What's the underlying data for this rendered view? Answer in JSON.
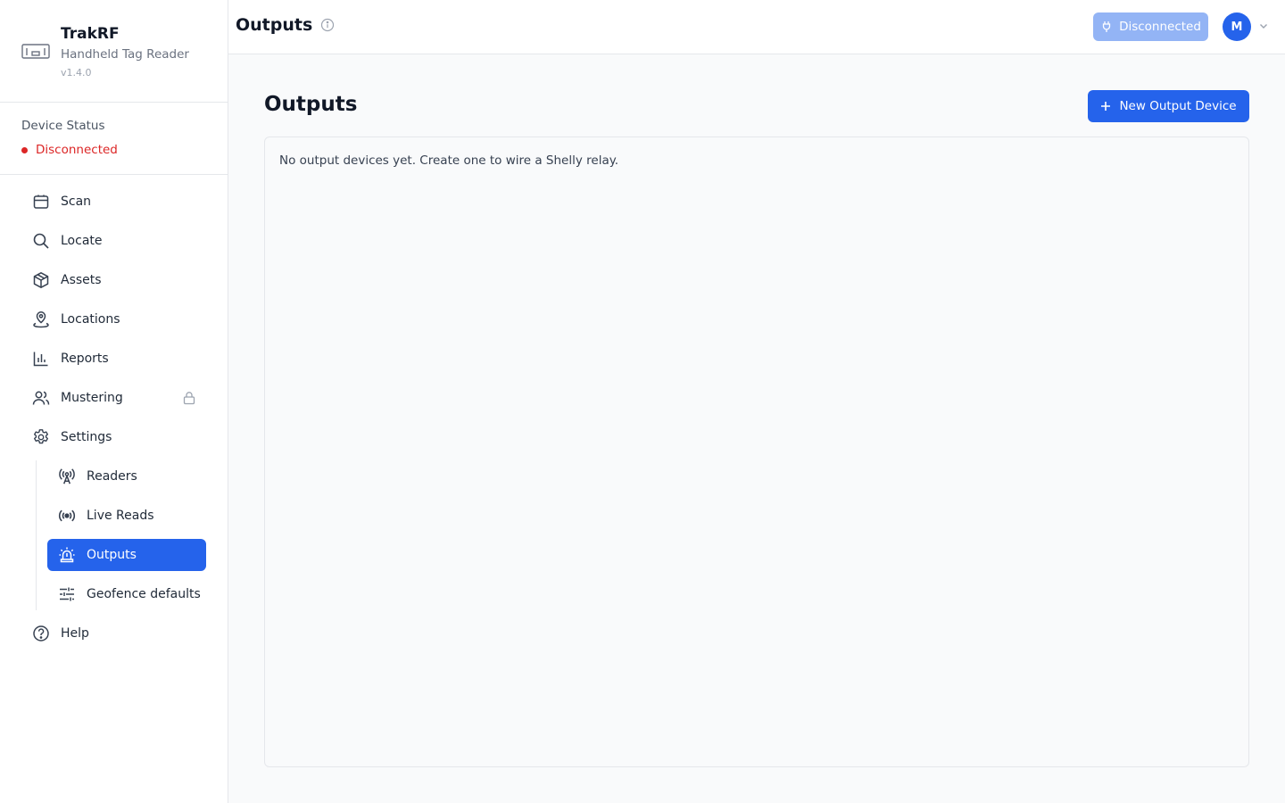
{
  "brand": {
    "name": "TrakRF",
    "subtitle": "Handheld Tag Reader",
    "version": "v1.4.0"
  },
  "device_status": {
    "title": "Device Status",
    "value": "Disconnected",
    "color": "#dc2626"
  },
  "nav": {
    "items": [
      {
        "label": "Scan",
        "icon": "scan-box-icon"
      },
      {
        "label": "Locate",
        "icon": "search-icon"
      },
      {
        "label": "Assets",
        "icon": "cube-icon"
      },
      {
        "label": "Locations",
        "icon": "location-pin-icon"
      },
      {
        "label": "Reports",
        "icon": "bar-chart-icon"
      },
      {
        "label": "Mustering",
        "icon": "users-icon",
        "locked": true
      },
      {
        "label": "Settings",
        "icon": "gear-icon"
      }
    ],
    "settings_sub": [
      {
        "label": "Readers",
        "icon": "antenna-icon"
      },
      {
        "label": "Live Reads",
        "icon": "broadcast-icon"
      },
      {
        "label": "Outputs",
        "icon": "siren-icon",
        "active": true
      },
      {
        "label": "Geofence defaults",
        "icon": "sliders-icon"
      }
    ],
    "help": {
      "label": "Help",
      "icon": "help-circle-icon"
    }
  },
  "header": {
    "title": "Outputs",
    "connection_label": "Disconnected",
    "avatar_initial": "M"
  },
  "main": {
    "title": "Outputs",
    "new_button_label": "New Output Device",
    "empty_message": "No output devices yet. Create one to wire a Shelly relay."
  },
  "colors": {
    "accent": "#2563eb",
    "disconnected_button": "#93b4f5",
    "error": "#dc2626"
  }
}
